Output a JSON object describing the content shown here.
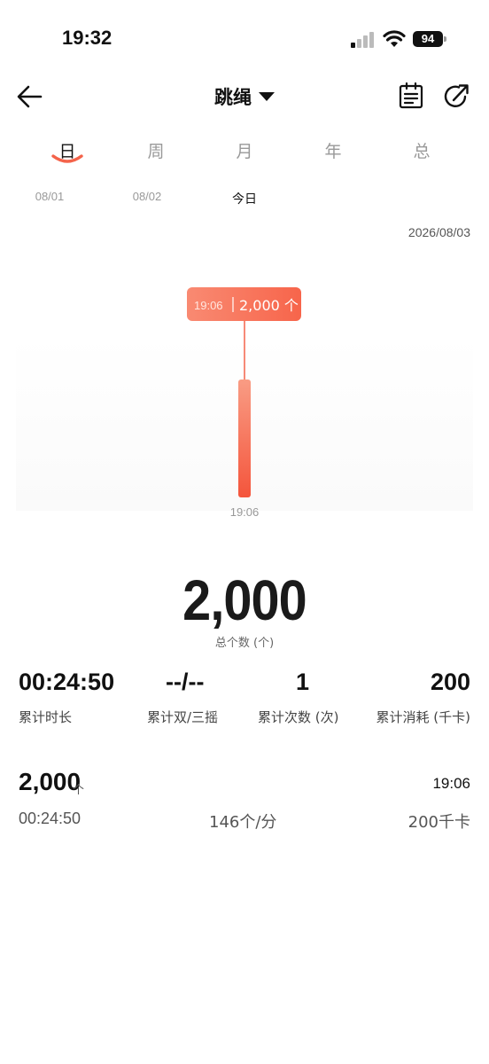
{
  "status_bar": {
    "time": "19:32",
    "battery": "94"
  },
  "nav": {
    "title": "跳绳",
    "icons": [
      "back-arrow-icon",
      "caret-down-icon",
      "notes-icon",
      "share-icon"
    ]
  },
  "period_tabs": [
    {
      "label": "日",
      "active": true
    },
    {
      "label": "周",
      "active": false
    },
    {
      "label": "月",
      "active": false
    },
    {
      "label": "年",
      "active": false
    },
    {
      "label": "总",
      "active": false
    }
  ],
  "date_tabs": [
    {
      "label": "08/01",
      "active": false
    },
    {
      "label": "08/02",
      "active": false
    },
    {
      "label": "今日",
      "active": true
    }
  ],
  "current_date": "2026/08/03",
  "colors": {
    "accent": "#f4634a",
    "accent_light": "#f99c84"
  },
  "chart_data": {
    "type": "bar",
    "categories": [
      "19:06"
    ],
    "values": [
      2000
    ],
    "tooltip": {
      "time": "19:06",
      "value": "2,000 个"
    },
    "x_tick_labels": [
      "19:06"
    ],
    "title": "",
    "xlabel": "",
    "ylabel": ""
  },
  "summary": {
    "total_count": "2,000",
    "total_label": "总个数 (个)"
  },
  "stats": [
    {
      "value": "00:24:50",
      "label": "累计时长"
    },
    {
      "value": "--/--",
      "label": "累计双/三摇"
    },
    {
      "value": "1",
      "label": "累计次数 (次)"
    },
    {
      "value": "200",
      "label": "累计消耗 (千卡)"
    }
  ],
  "record": {
    "count": "2,000",
    "unit": "个",
    "time": "19:06",
    "duration": "00:24:50",
    "pace": "146个/分",
    "calories": "200千卡"
  }
}
